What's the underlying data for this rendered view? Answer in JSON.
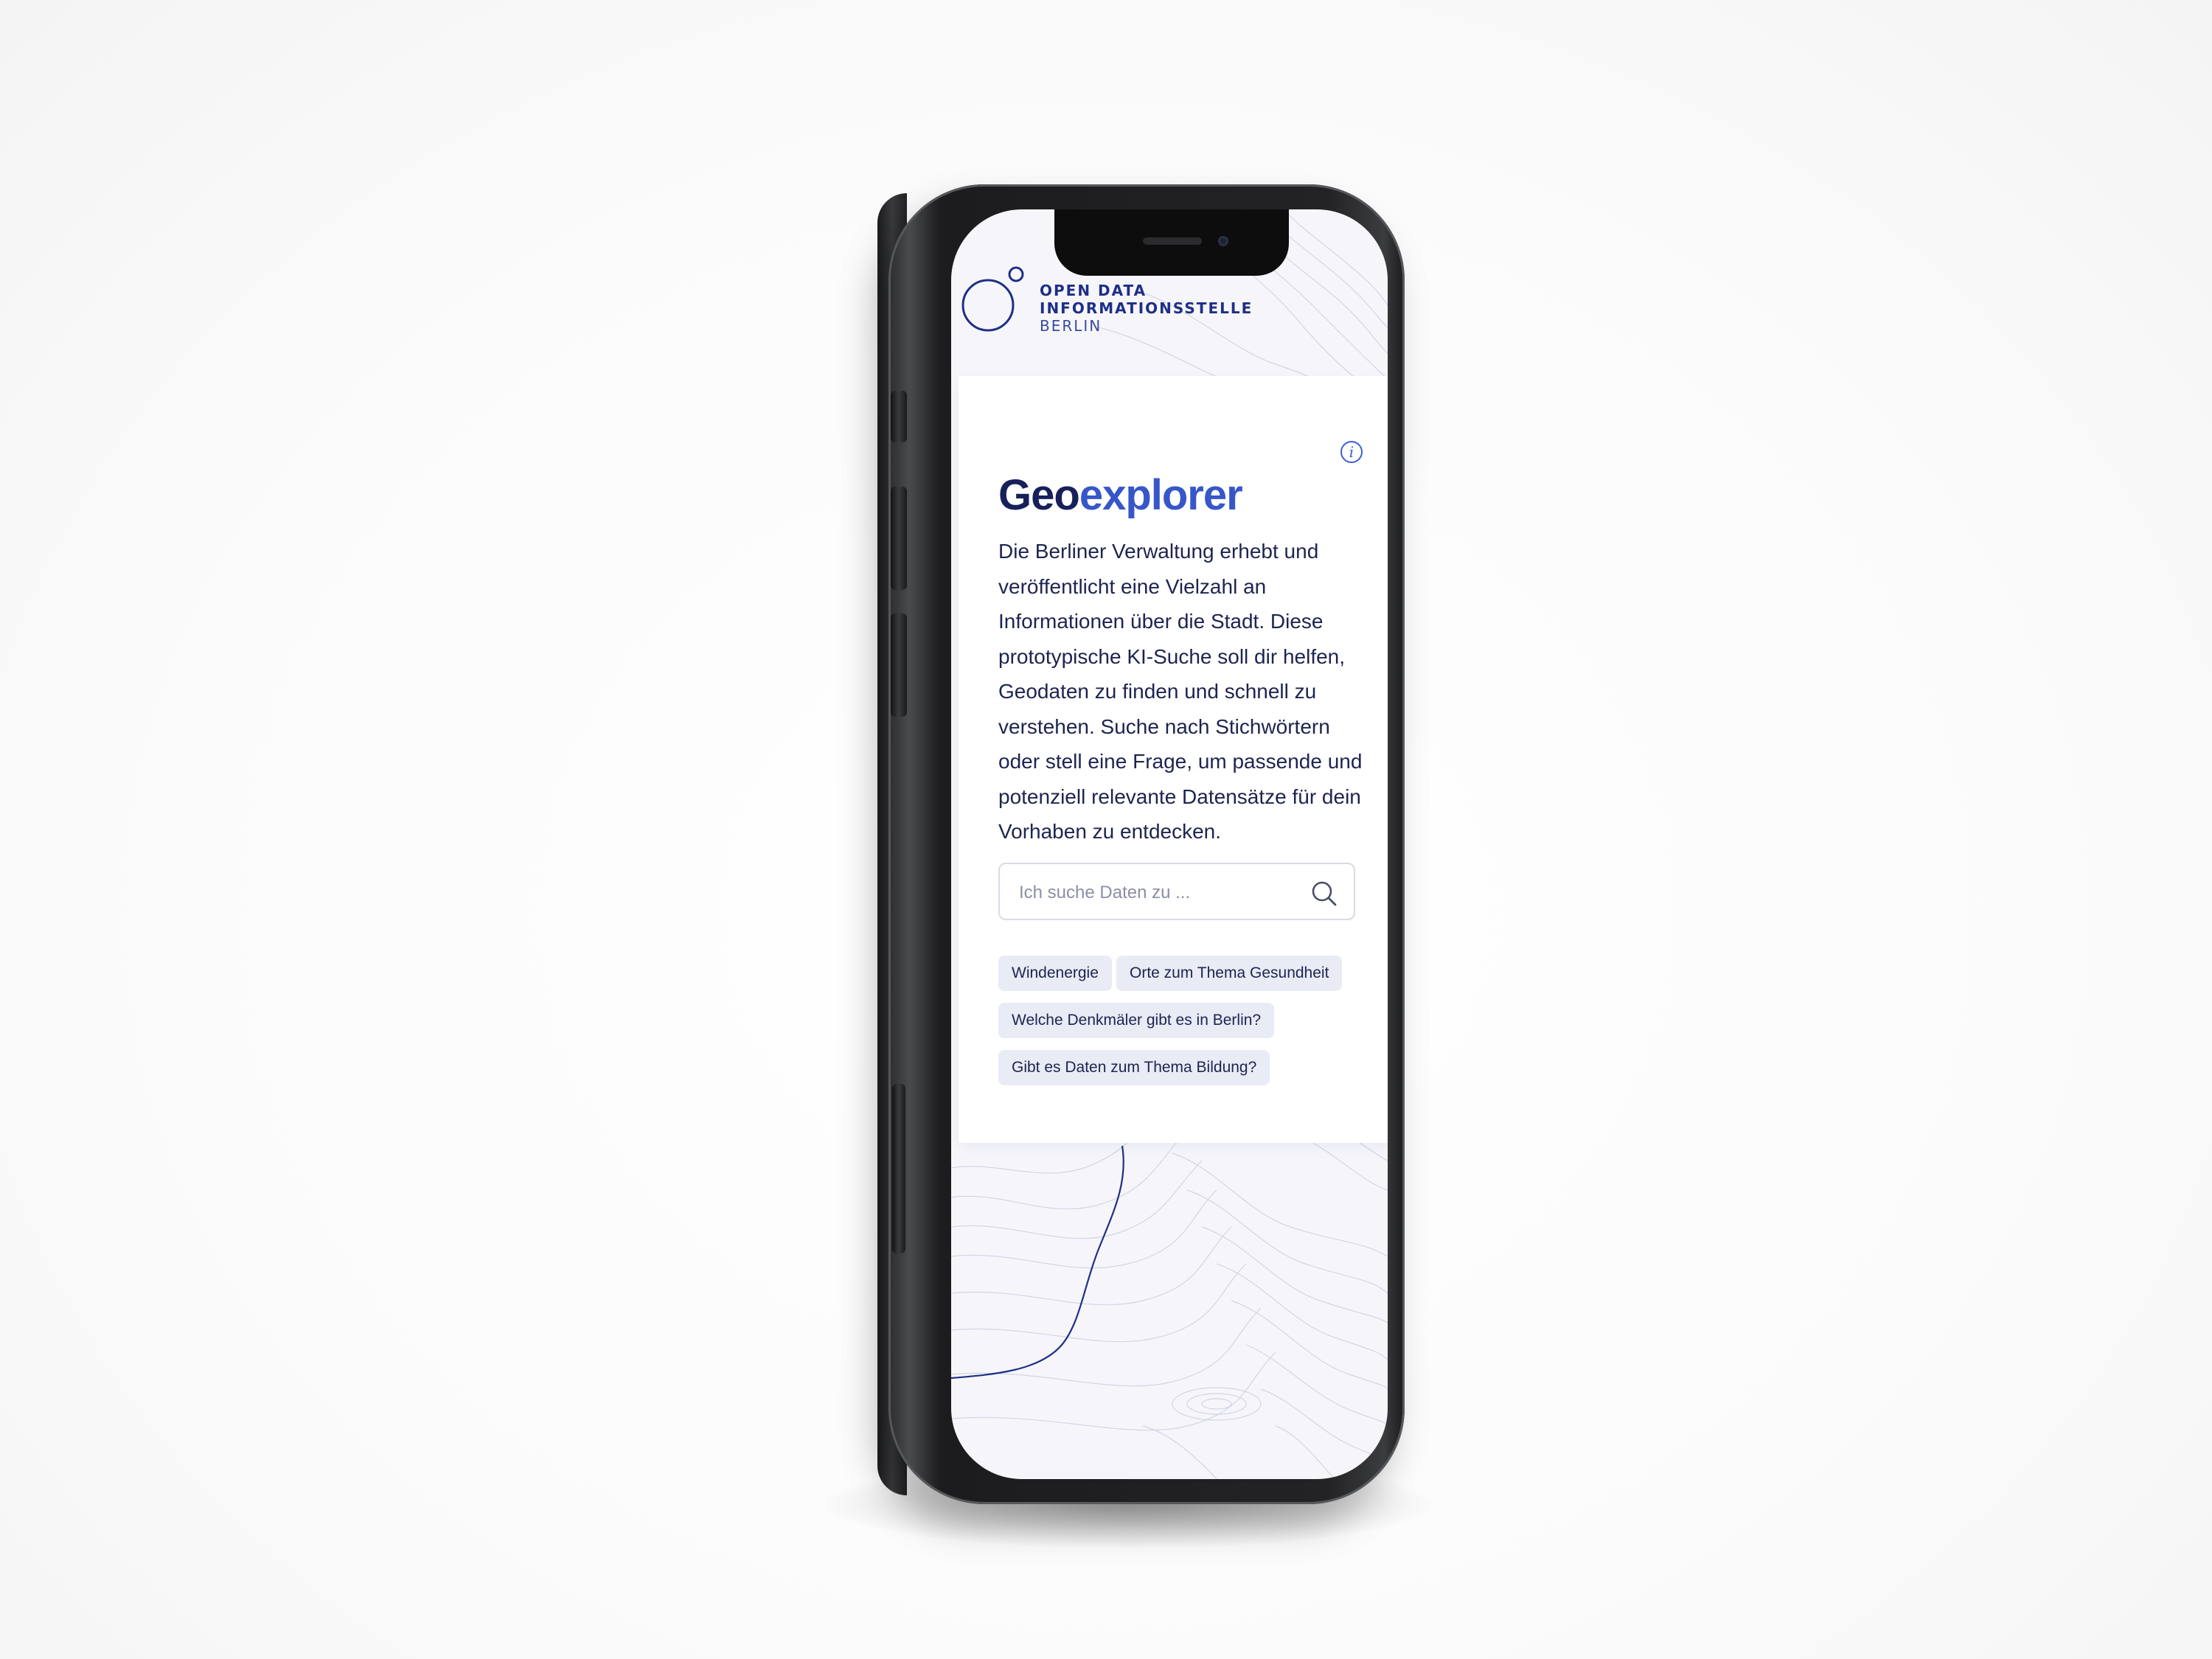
{
  "logo": {
    "line1": "OPEN DATA",
    "line2": "INFORMATIONSSTELLE",
    "line3": "BERLIN"
  },
  "card": {
    "title_part1": "Geo",
    "title_part2": "explorer",
    "info_glyph": "i",
    "description": "Die Berliner Verwaltung erhebt und veröffentlicht eine Vielzahl an Informationen über die Stadt. Diese prototypische KI-Suche soll dir helfen, Geodaten zu finden und schnell zu verstehen. Suche nach Stichwörtern oder stell eine Frage, um passende und potenziell relevante Datensätze für dein Vorhaben zu entdecken.",
    "search": {
      "placeholder": "Ich suche Daten zu ...",
      "value": ""
    },
    "suggestions": [
      "Windenergie",
      "Orte zum Thema Gesundheit",
      "Welche Denkmäler gibt es in Berlin?",
      "Gibt es Daten zum Thema Bildung?"
    ]
  },
  "icons": {
    "info": "info-icon",
    "search": "search-icon",
    "logo": "odis-logo-icon"
  },
  "colors": {
    "brand_dark": "#16205a",
    "brand_accent": "#3656c9",
    "chip_bg": "#e9ebf5",
    "background": "#f6f6fa"
  }
}
